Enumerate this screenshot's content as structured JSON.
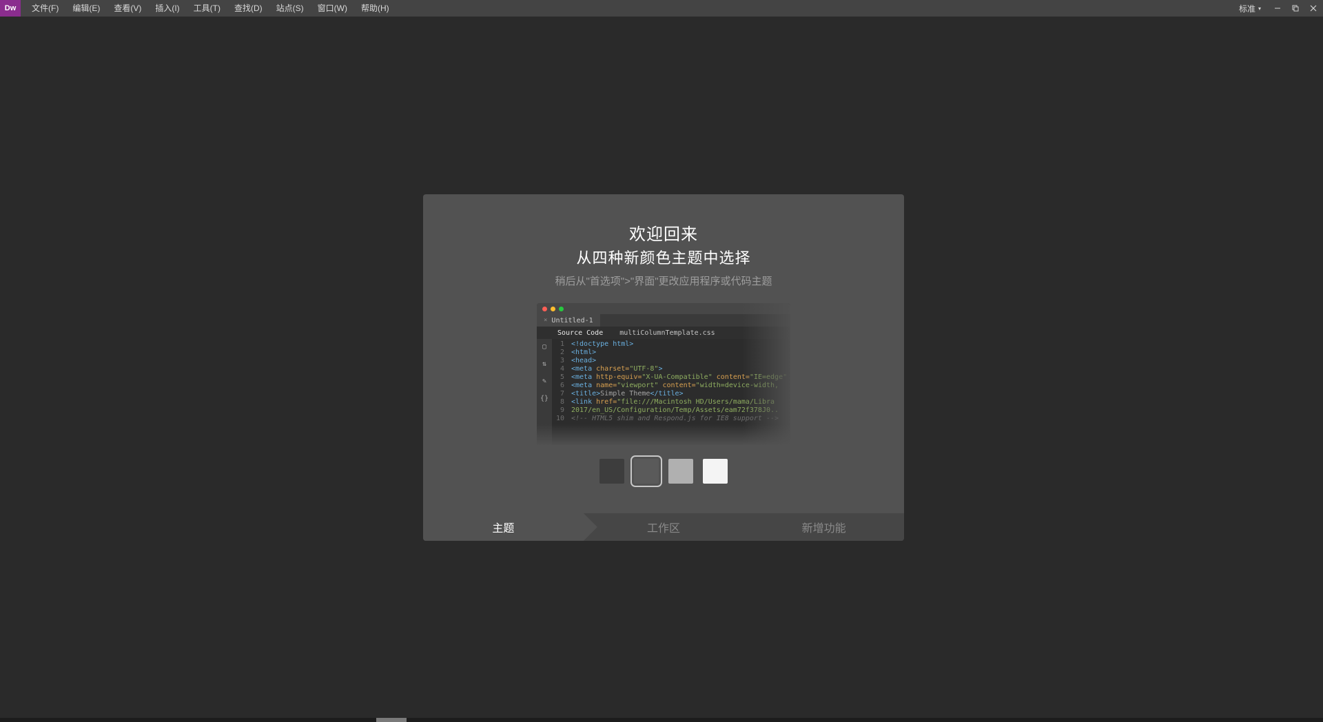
{
  "app": {
    "logo_text": "Dw"
  },
  "menu": {
    "items": [
      "文件(F)",
      "编辑(E)",
      "查看(V)",
      "插入(I)",
      "工具(T)",
      "查找(D)",
      "站点(S)",
      "窗口(W)",
      "帮助(H)"
    ],
    "workspace_label": "标准"
  },
  "welcome": {
    "title": "欢迎回来",
    "subtitle": "从四种新颜色主题中选择",
    "hint": "稍后从\"首选项\">\"界面\"更改应用程序或代码主题",
    "swatches": [
      "#3d3d3d",
      "#5a5a5a",
      "#b0b0b0",
      "#f4f4f4"
    ],
    "selected_index": 1,
    "tabs": [
      "主题",
      "工作区",
      "新增功能"
    ],
    "active_tab_index": 0
  },
  "preview": {
    "tab_label": "Untitled-1",
    "source_label": "Source Code",
    "file_label": "multiColumnTemplate.css",
    "lines": [
      {
        "n": 1,
        "html": "<span class='tok-tag'>&lt;!doctype html&gt;</span>"
      },
      {
        "n": 2,
        "html": "<span class='tok-tag'>&lt;html&gt;</span>"
      },
      {
        "n": 3,
        "html": "<span class='tok-tag'>&lt;head&gt;</span>"
      },
      {
        "n": 4,
        "html": "<span class='tok-tag'>&lt;meta</span> <span class='tok-attr'>charset=</span><span class='tok-str'>\"UTF-8\"</span><span class='tok-tag'>&gt;</span>"
      },
      {
        "n": 5,
        "html": "<span class='tok-tag'>&lt;meta</span> <span class='tok-attr'>http-equiv=</span><span class='tok-str'>\"X-UA-Compatible\"</span> <span class='tok-attr'>content=</span><span class='tok-str'>\"IE=edge\"</span>"
      },
      {
        "n": 6,
        "html": "<span class='tok-tag'>&lt;meta</span> <span class='tok-attr'>name=</span><span class='tok-str'>\"viewport\"</span> <span class='tok-attr'>content=</span><span class='tok-str'>\"width=device-width,</span>"
      },
      {
        "n": 7,
        "html": "<span class='tok-tag'>&lt;title&gt;</span><span class='tok-c'>Simple Theme</span><span class='tok-tag'>&lt;/title&gt;</span>"
      },
      {
        "n": 8,
        "html": "<span class='tok-tag'>&lt;link</span> <span class='tok-attr'>href=</span><span class='tok-str'>\"file:///Macintosh HD/Users/mama/Libra</span>"
      },
      {
        "n": 9,
        "html": "<span class='tok-str'>2017/en_US/Configuration/Temp/Assets/eam72f378J0..</span>"
      },
      {
        "n": 10,
        "html": "<span class='tok-cmt'>&lt;!-- HTML5 shim and Respond.js for IE8 support --&gt;</span>"
      }
    ]
  }
}
